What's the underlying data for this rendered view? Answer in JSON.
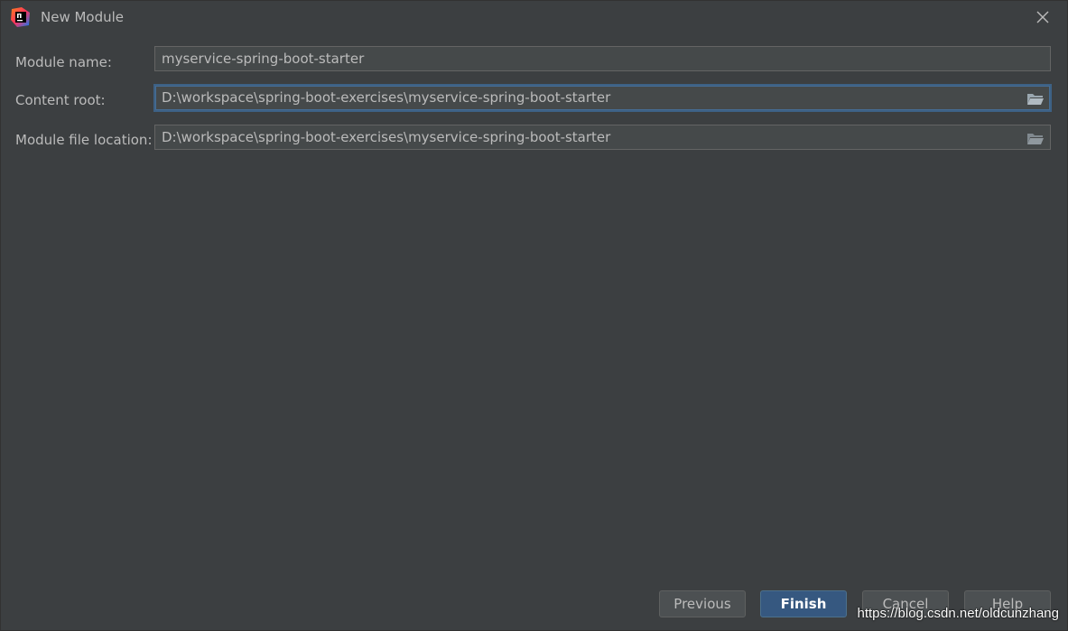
{
  "window": {
    "title": "New Module",
    "app_icon": "intellij-icon",
    "close_icon": "close-icon"
  },
  "form": {
    "module_name": {
      "label": "Module name:",
      "value": "myservice-spring-boot-starter"
    },
    "content_root": {
      "label": "Content root:",
      "value": "D:\\workspace\\spring-boot-exercises\\myservice-spring-boot-starter",
      "browse_icon": "folder-icon"
    },
    "module_file_location": {
      "label": "Module file location:",
      "value": "D:\\workspace\\spring-boot-exercises\\myservice-spring-boot-starter",
      "browse_icon": "folder-icon"
    }
  },
  "buttons": {
    "previous": "Previous",
    "finish": "Finish",
    "cancel": "Cancel",
    "help": "Help"
  },
  "watermark": "https://blog.csdn.net/oldcunzhang",
  "colors": {
    "background": "#3c3f41",
    "field_bg": "#45494a",
    "focus_border": "#3d6185",
    "primary_button": "#365880",
    "text": "#bbbbbb"
  }
}
